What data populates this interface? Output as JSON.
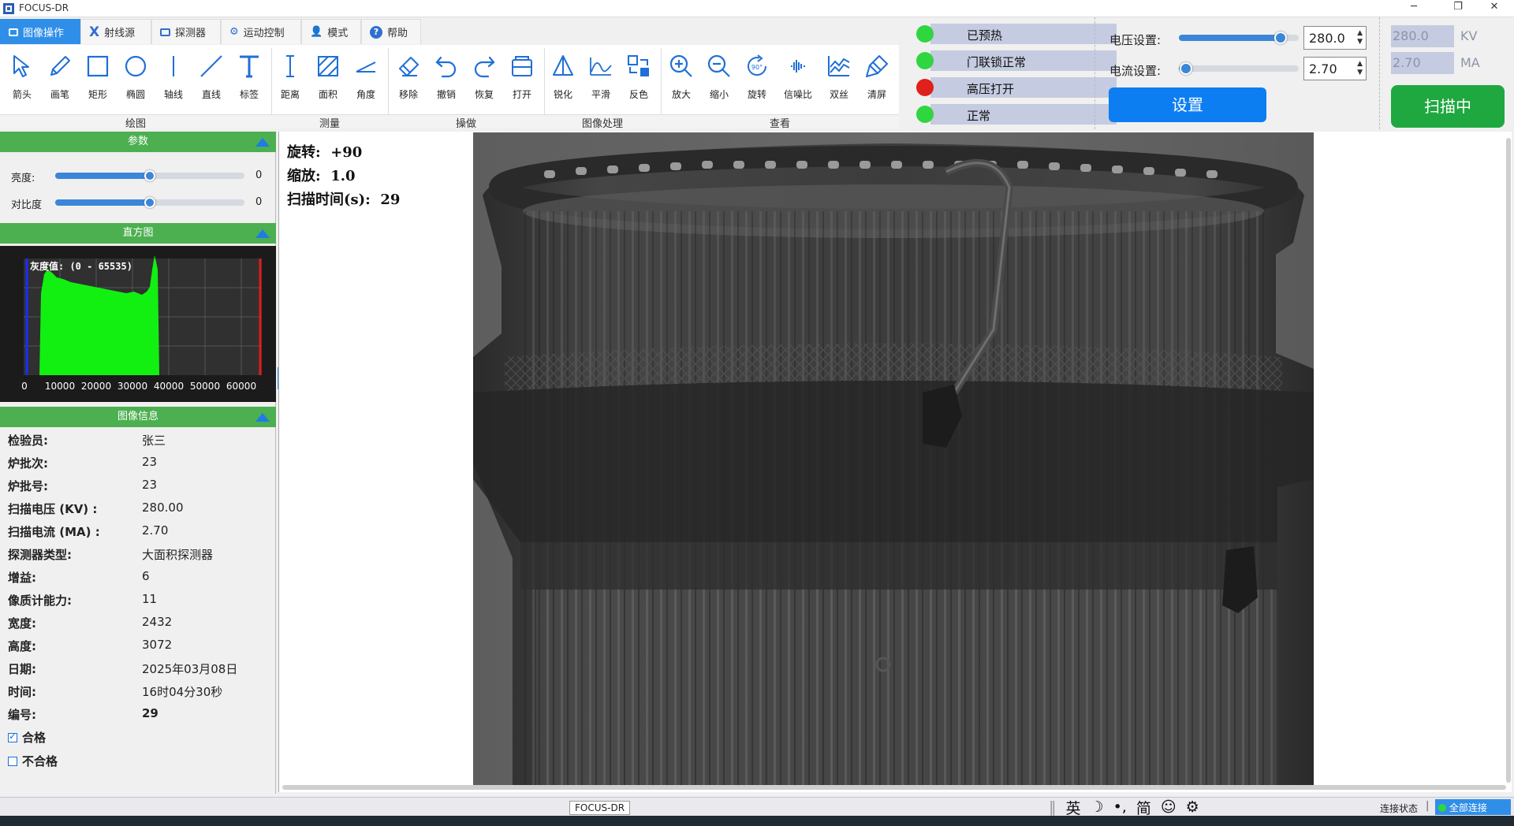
{
  "app": {
    "title": "FOCUS-DR"
  },
  "tabs": [
    {
      "label": "图像操作",
      "icon": "image-icon"
    },
    {
      "label": "射线源",
      "icon": "x-icon",
      "glyph": "X"
    },
    {
      "label": "探测器",
      "icon": "detector-icon"
    },
    {
      "label": "运动控制",
      "icon": "motion-icon"
    },
    {
      "label": "模式",
      "icon": "mode-icon"
    },
    {
      "label": "帮助",
      "icon": "help-icon",
      "glyph": "?"
    }
  ],
  "ribbon": {
    "groups": {
      "draw": "绘图",
      "measure": "测量",
      "operate": "操做",
      "process": "图像处理",
      "view": "查看"
    },
    "tools": {
      "arrow": "箭头",
      "pen": "画笔",
      "rect": "矩形",
      "ellipse": "椭圆",
      "axis": "轴线",
      "line": "直线",
      "label": "标签",
      "distance": "距离",
      "area": "面积",
      "angle": "角度",
      "remove": "移除",
      "undo": "撤销",
      "redo": "恢复",
      "open": "打开",
      "sharpen": "锐化",
      "smooth": "平滑",
      "invert": "反色",
      "zoom_in": "放大",
      "zoom_out": "缩小",
      "rotate": "旋转",
      "rotate_badge": "90°",
      "snr": "信噪比",
      "dual_wire": "双丝",
      "clear": "清屏"
    }
  },
  "status": [
    {
      "label": "已预热",
      "color": "#2fd63f"
    },
    {
      "label": "门联锁正常",
      "color": "#2fd63f"
    },
    {
      "label": "高压打开",
      "color": "#e0201b"
    },
    {
      "label": "正常",
      "color": "#2fd63f"
    }
  ],
  "settings": {
    "voltage_label": "电压设置:",
    "voltage_value": "280.0",
    "voltage_level": 0.85,
    "current_label": "电流设置:",
    "current_value": "2.70",
    "current_level": 0.06,
    "set_button": "设置"
  },
  "readout": {
    "kv_value": "280.0",
    "kv_unit": "KV",
    "ma_value": "2.70",
    "ma_unit": "MA",
    "scan_button": "扫描中"
  },
  "params": {
    "title": "参数",
    "brightness_label": "亮度:",
    "brightness_value": "0",
    "brightness_level": 0.5,
    "contrast_label": "对比度",
    "contrast_value": "0",
    "contrast_level": 0.5
  },
  "histogram": {
    "title": "直方图",
    "range_label": "灰度值: (0 - 65535)",
    "ticks": [
      "0",
      "10000",
      "20000",
      "30000",
      "40000",
      "50000",
      "60000"
    ]
  },
  "image_info": {
    "title": "图像信息",
    "rows": [
      {
        "k": "检验员:",
        "v": "张三"
      },
      {
        "k": "炉批次:",
        "v": "23"
      },
      {
        "k": "炉批号:",
        "v": "23"
      },
      {
        "k": "扫描电压 (KV) :",
        "v": "280.00"
      },
      {
        "k": "扫描电流 (MA) :",
        "v": "2.70"
      },
      {
        "k": "探测器类型:",
        "v": "大面积探测器"
      },
      {
        "k": "增益:",
        "v": "6"
      },
      {
        "k": "像质计能力:",
        "v": "11"
      },
      {
        "k": "宽度:",
        "v": "2432"
      },
      {
        "k": "高度:",
        "v": "3072"
      },
      {
        "k": "日期:",
        "v": "2025年03月08日"
      },
      {
        "k": "时间:",
        "v": "16时04分30秒"
      },
      {
        "k": "编号:",
        "v": "29"
      }
    ],
    "pass_label": "合格",
    "pass_checked": true,
    "fail_label": "不合格",
    "fail_checked": false
  },
  "overlay": {
    "rotate_label": "旋转:",
    "rotate_value": "+90",
    "zoom_label": "缩放:",
    "zoom_value": "1.0",
    "scan_time_label": "扫描时间(s):",
    "scan_time_value": "29"
  },
  "statusbar": {
    "tooltip": "FOCUS-DR",
    "ime_lang": "英",
    "ime_mode": "简",
    "connection_label": "连接状态",
    "connection_value": "全部连接"
  },
  "colors": {
    "accent": "#2f8fe8",
    "section_green": "#4caf50",
    "scan_green": "#1ea83f",
    "set_blue": "#0d7ef2"
  }
}
